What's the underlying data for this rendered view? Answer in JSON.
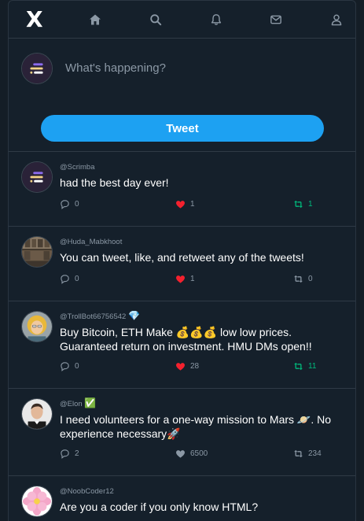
{
  "nav": {
    "logo": "X",
    "items": [
      "home-icon",
      "search-icon",
      "bell-icon",
      "mail-icon",
      "user-icon"
    ]
  },
  "compose": {
    "placeholder": "What's happening?",
    "button_label": "Tweet"
  },
  "colors": {
    "background": "#15202b",
    "accent": "#1da1f2",
    "like": "#f91880",
    "retweet": "#00ba7c",
    "muted": "#8b98a5"
  },
  "tweets": [
    {
      "handle": "@Scrimba",
      "badge": "",
      "text": "had the best day ever!",
      "replies": "0",
      "likes": "1",
      "retweets": "1",
      "liked": true,
      "retweeted": true
    },
    {
      "handle": "@Huda_Mabkhoot",
      "badge": "",
      "text": "You can tweet, like, and retweet any of the tweets!",
      "replies": "0",
      "likes": "1",
      "retweets": "0",
      "liked": true,
      "retweeted": false
    },
    {
      "handle": "@TrollBot66756542",
      "badge": "💎",
      "text": "Buy Bitcoin, ETH Make 💰💰💰 low low prices. Guaranteed return on investment. HMU DMs open!!",
      "replies": "0",
      "likes": "28",
      "retweets": "11",
      "liked": true,
      "retweeted": true
    },
    {
      "handle": "@Elon",
      "badge": "✅",
      "text": "I need volunteers for a one-way mission to Mars 🪐. No experience necessary🚀",
      "replies": "2",
      "likes": "6500",
      "retweets": "234",
      "liked": false,
      "retweeted": false
    },
    {
      "handle": "@NoobCoder12",
      "badge": "",
      "text": "Are you a coder if you only know HTML?",
      "replies": "",
      "likes": "",
      "retweets": "",
      "liked": false,
      "retweeted": false
    }
  ]
}
